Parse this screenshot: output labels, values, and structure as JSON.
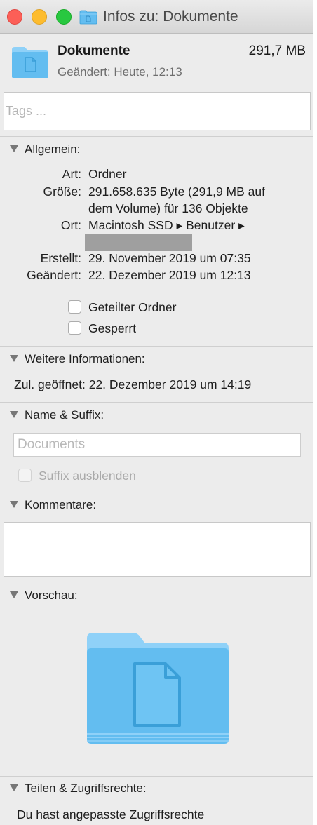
{
  "window": {
    "title": "Infos zu: Dokumente"
  },
  "header": {
    "name": "Dokumente",
    "size": "291,7 MB",
    "modified": "Geändert: Heute, 12:13",
    "icon": "blue-documents-folder"
  },
  "tags": {
    "placeholder": "Tags ..."
  },
  "general": {
    "heading": "Allgemein:",
    "kind_label": "Art:",
    "kind_value": "Ordner",
    "size_label": "Größe:",
    "size_value_line1": "291.658.635 Byte (291,9 MB auf",
    "size_value_line2": "dem Volume) für 136 Objekte",
    "where_label": "Ort:",
    "where_value": "Macintosh SSD ▸ Benutzer ▸",
    "created_label": "Erstellt:",
    "created_value": "29. November 2019 um 07:35",
    "modified_label": "Geändert:",
    "modified_value": "22. Dezember 2019 um 12:13",
    "shared_folder_label": "Geteilter Ordner",
    "shared_folder_checked": false,
    "locked_label": "Gesperrt",
    "locked_checked": false
  },
  "more_info": {
    "heading": "Weitere Informationen:",
    "last_opened": "Zul. geöffnet: 22. Dezember 2019 um 14:19"
  },
  "name_extension": {
    "heading": "Name & Suffix:",
    "name_placeholder": "Documents",
    "hide_extension_label": "Suffix ausblenden",
    "hide_extension_checked": false
  },
  "comments": {
    "heading": "Kommentare:",
    "value": ""
  },
  "preview": {
    "heading": "Vorschau:",
    "icon": "blue-documents-folder"
  },
  "sharing": {
    "heading": "Teilen & Zugriffsrechte:",
    "text": "Du hast angepasste Zugriffsrechte"
  },
  "colors": {
    "folder_light": "#8fd1f8",
    "folder_main": "#63bdf0",
    "folder_dark": "#3a9fd8"
  }
}
